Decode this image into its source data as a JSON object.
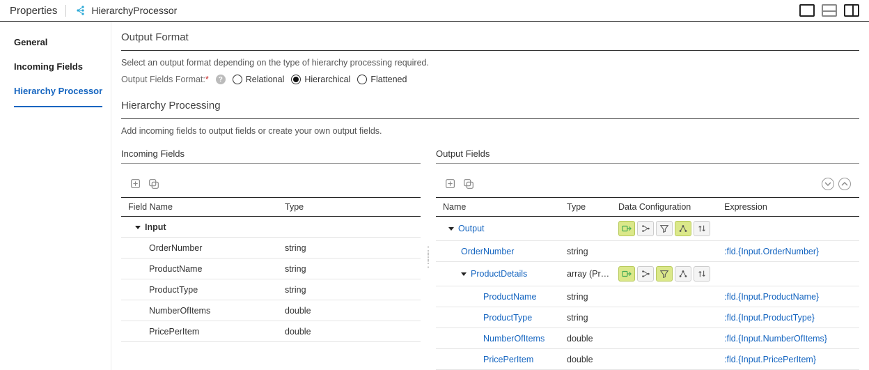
{
  "header": {
    "panel_title": "Properties",
    "node_name": "HierarchyProcessor"
  },
  "sidebar": {
    "items": [
      {
        "label": "General"
      },
      {
        "label": "Incoming Fields"
      },
      {
        "label": "Hierarchy Processor"
      }
    ],
    "selected_index": 2
  },
  "output_format": {
    "title": "Output Format",
    "description": "Select an output format depending on the type of hierarchy processing required.",
    "field_label": "Output Fields Format:",
    "options": [
      "Relational",
      "Hierarchical",
      "Flattened"
    ],
    "selected": "Hierarchical"
  },
  "processing": {
    "title": "Hierarchy Processing",
    "description": "Add incoming fields to output fields or create your own output fields."
  },
  "incoming": {
    "title": "Incoming Fields",
    "columns": {
      "name": "Field Name",
      "type": "Type"
    },
    "group": "Input",
    "rows": [
      {
        "name": "OrderNumber",
        "type": "string"
      },
      {
        "name": "ProductName",
        "type": "string"
      },
      {
        "name": "ProductType",
        "type": "string"
      },
      {
        "name": "NumberOfItems",
        "type": "double"
      },
      {
        "name": "PricePerItem",
        "type": "double"
      }
    ]
  },
  "output": {
    "title": "Output Fields",
    "columns": {
      "name": "Name",
      "type": "Type",
      "cfg": "Data Configuration",
      "expr": "Expression"
    },
    "rows": [
      {
        "level": 0,
        "link": true,
        "caret": true,
        "name": "Output",
        "type": "",
        "cfg": true,
        "active": [
          0,
          3
        ],
        "expr": ""
      },
      {
        "level": 1,
        "link": true,
        "caret": false,
        "name": "OrderNumber",
        "type": "string",
        "cfg": false,
        "expr": ":fld.{Input.OrderNumber}"
      },
      {
        "level": 2,
        "link": true,
        "caret": true,
        "name": "ProductDetails",
        "type": "array (Pr…",
        "cfg": true,
        "active": [
          0,
          2
        ],
        "expr": ""
      },
      {
        "level": 3,
        "link": true,
        "caret": false,
        "name": "ProductName",
        "type": "string",
        "cfg": false,
        "expr": ":fld.{Input.ProductName}"
      },
      {
        "level": 3,
        "link": true,
        "caret": false,
        "name": "ProductType",
        "type": "string",
        "cfg": false,
        "expr": ":fld.{Input.ProductType}"
      },
      {
        "level": 3,
        "link": true,
        "caret": false,
        "name": "NumberOfItems",
        "type": "double",
        "cfg": false,
        "expr": ":fld.{Input.NumberOfItems}"
      },
      {
        "level": 3,
        "link": true,
        "caret": false,
        "name": "PricePerItem",
        "type": "double",
        "cfg": false,
        "expr": ":fld.{Input.PricePerItem}"
      }
    ]
  },
  "icons": {
    "cfg_names": [
      "data-source-icon",
      "join-icon",
      "filter-icon",
      "group-by-icon",
      "order-by-icon"
    ]
  }
}
